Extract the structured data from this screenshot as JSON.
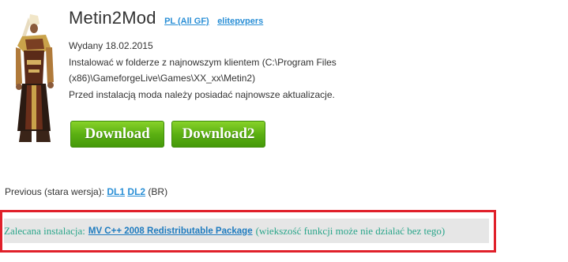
{
  "mod": {
    "title": "Metin2Mod",
    "tags": [
      "PL (All GF)",
      "elitepvpers"
    ],
    "released": "Wydany 18.02.2015",
    "install_line1": "Instalować w folderze z najnowszym klientem (C:\\Program Files",
    "install_line2": "(x86)\\GameforgeLive\\Games\\XX_xx\\Metin2)",
    "install_line3": "Przed instalacją moda należy posiadać najnowsze aktualizacje."
  },
  "buttons": {
    "download": "Download",
    "download2": "Download2"
  },
  "previous": {
    "label": "Previous (stara wersja):",
    "link1": "DL1",
    "link2": "DL2",
    "suffix": "(BR)"
  },
  "recommended": {
    "label": "Zalecana instalacja:",
    "link": "MV C++ 2008 Redistributable Package",
    "note": "(wiekszość funkcji może nie dzialać bez tego)"
  },
  "colors": {
    "link": "#2a8fd6",
    "button_green": "#5bb012",
    "highlight_border": "#e0202a",
    "recommended_text": "#2aa58a"
  }
}
